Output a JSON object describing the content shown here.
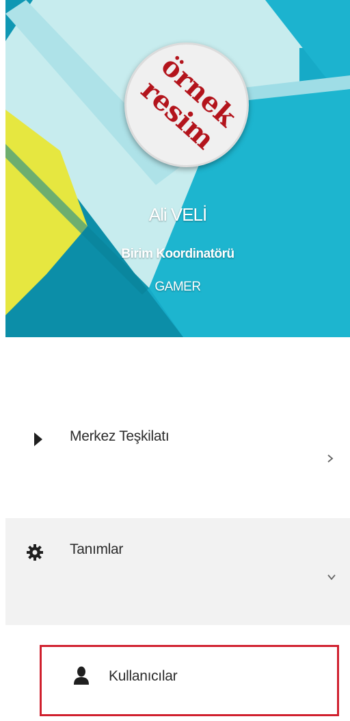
{
  "profile": {
    "avatar_text_line1": "örnek",
    "avatar_text_line2": "resim",
    "name": "Ali VELİ",
    "role": "Birim Koordinatörü",
    "organization": "GAMER"
  },
  "menu": {
    "items": [
      {
        "label": "Merkez Teşkilatı",
        "icon": "caret-right-icon",
        "chevron": "chevron-right-icon"
      },
      {
        "label": "Tanımlar",
        "icon": "gear-icon",
        "chevron": "chevron-down-icon",
        "expanded": true
      },
      {
        "label": "Kullanıcılar",
        "icon": "user-icon",
        "highlighted": true
      }
    ]
  },
  "colors": {
    "header_teal": "#14a9c6",
    "header_light": "#c7ecee",
    "header_yellow": "#e6e740",
    "avatar_text": "#b3141c",
    "highlight_border": "#d0202e",
    "expanded_bg": "#f2f2f2"
  }
}
